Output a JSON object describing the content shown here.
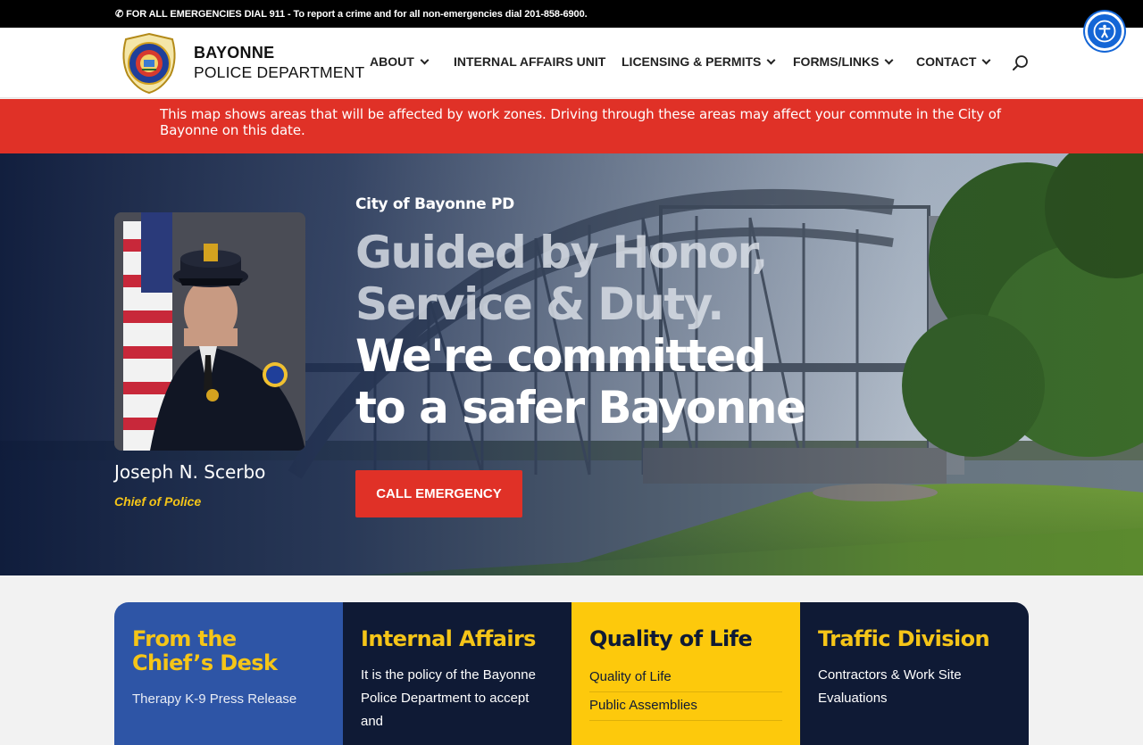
{
  "topbar": {
    "message": "FOR ALL EMERGENCIES DIAL 911 - To report a crime and for all non-emergencies dial 201-858-6900.",
    "phone_icon": "phone-icon"
  },
  "accessibility": {
    "icon": "accessibility-icon"
  },
  "header": {
    "brand_line1": "BAYONNE",
    "brand_line2": "POLICE DEPARTMENT",
    "logo_icon": "police-badge-logo",
    "nav": [
      {
        "label": "ABOUT",
        "has_dropdown": true
      },
      {
        "label": "INTERNAL AFFAIRS UNIT",
        "has_dropdown": false
      },
      {
        "label": "LICENSING & PERMITS",
        "has_dropdown": true
      },
      {
        "label": "FORMS/LINKS",
        "has_dropdown": true
      },
      {
        "label": "CONTACT",
        "has_dropdown": true
      }
    ],
    "search_icon": "search-icon"
  },
  "alert": {
    "text": "This map shows areas that will be affected by work zones. Driving through these areas may affect your commute in the City of Bayonne on this date."
  },
  "hero": {
    "chief_name": "Joseph N. Scerbo",
    "chief_title": "Chief of Police",
    "kicker": "City of Bayonne PD",
    "headline_faded_1": "Guided by Honor,",
    "headline_faded_2": "Service & Duty.",
    "headline_solid_1": "We're committed",
    "headline_solid_2": "to a safer Bayonne",
    "cta_label": "CALL EMERGENCY"
  },
  "cards": {
    "chiefs_desk": {
      "title_1": "From the",
      "title_2": "Chief’s Desk",
      "link": "Therapy K-9 Press Release"
    },
    "internal_affairs": {
      "title": "Internal Affairs",
      "text_1": "It is the policy of the Bayonne",
      "text_2": "Police Department to accept and"
    },
    "quality_of_life": {
      "title": "Quality of Life",
      "links": [
        "Quality of Life",
        "Public Assemblies"
      ]
    },
    "traffic": {
      "title": "Traffic Division",
      "link_1": "Contractors & Work Site",
      "link_2": "Evaluations"
    }
  },
  "colors": {
    "alert_red": "#e03127",
    "accent_yellow": "#f5c518",
    "navy": "#0f1a35",
    "blue": "#2e55a6",
    "a11y_blue": "#1466d6"
  }
}
